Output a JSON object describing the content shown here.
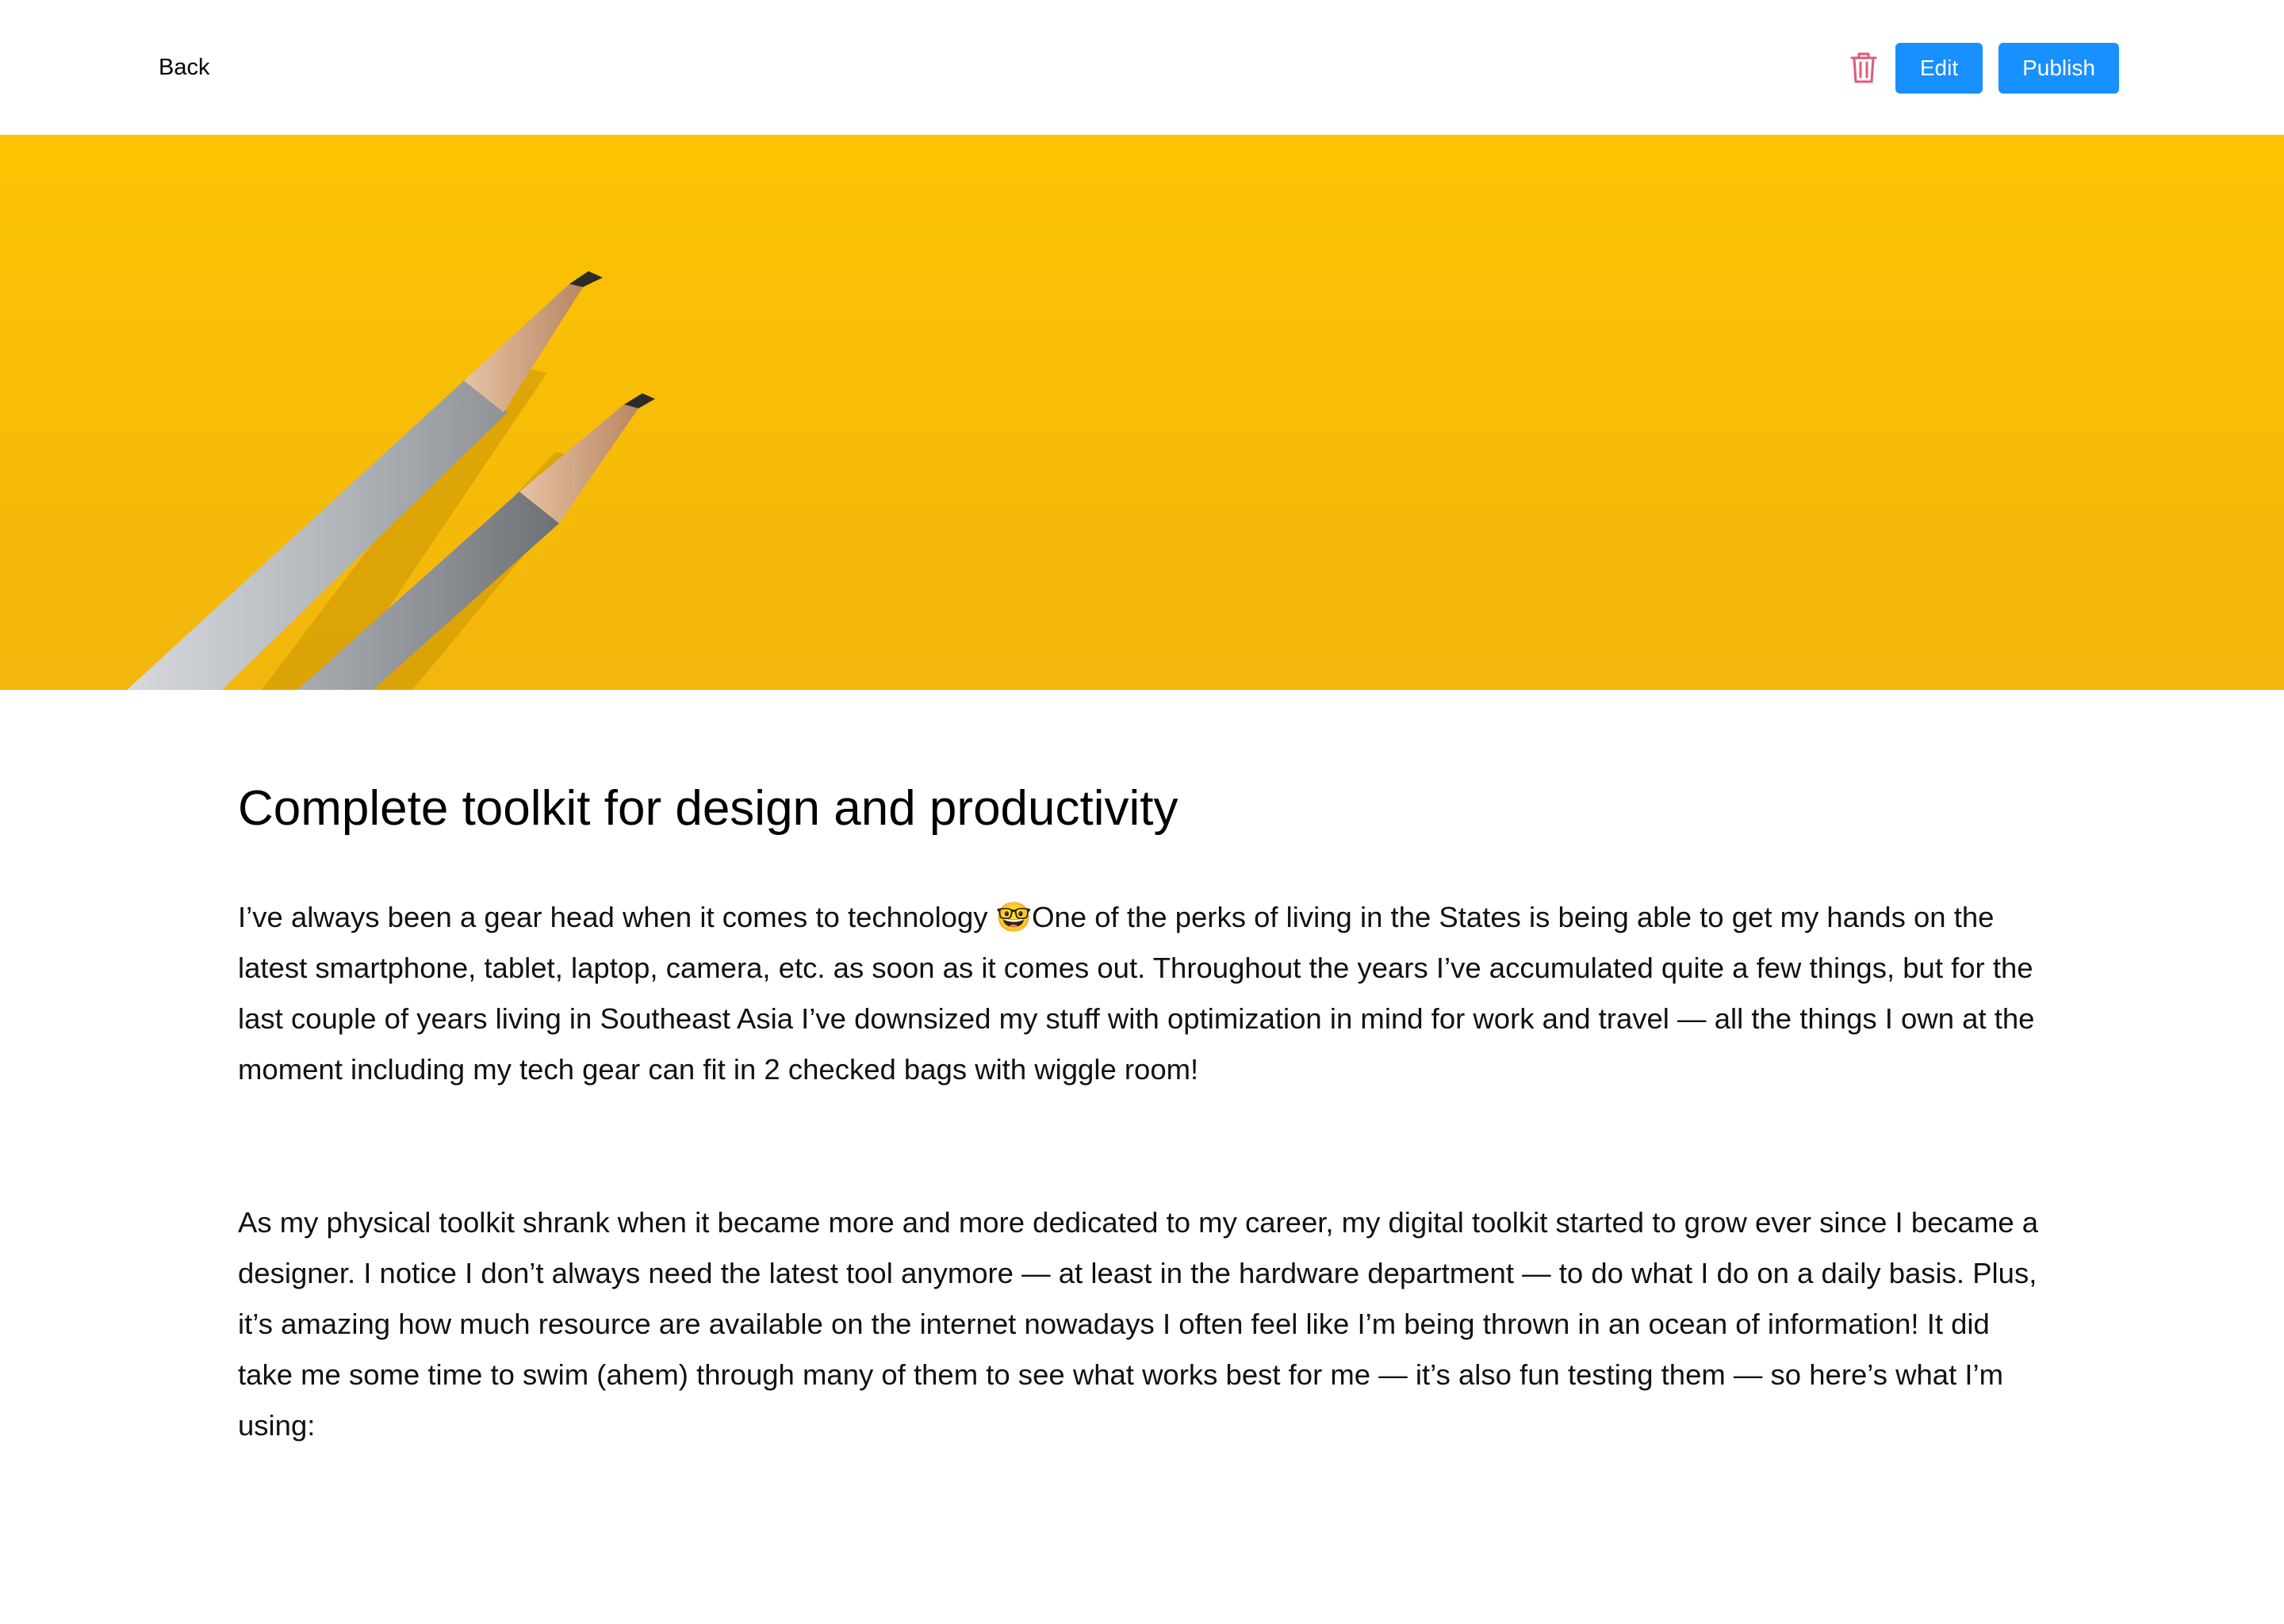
{
  "header": {
    "back_label": "Back",
    "delete_icon": "trash-icon",
    "edit_label": "Edit",
    "publish_label": "Publish"
  },
  "hero": {
    "image": "yellow-background-two-pencils",
    "colors": {
      "background": "#f8be06",
      "pencil_body": "#b9bcc1",
      "pencil_wood": "#d8aa86"
    }
  },
  "article": {
    "title": "Complete toolkit for design and productivity",
    "paragraphs": [
      "I’ve always been a gear head when it comes to technology 🤓One of the perks of living in the States is being able to get my hands on the latest smartphone, tablet, laptop, camera, etc. as soon as it comes out. Throughout the years I’ve accumulated quite a few things, but for the last couple of years living in Southeast Asia I’ve downsized my stuff with optimization in mind for work and travel — all the things I own at the moment including my tech gear can fit in 2 checked bags with wiggle room!",
      "As my physical toolkit shrank when it became more and more dedicated to my career, my digital toolkit started to grow ever since I became a designer. I notice I don’t always need the latest tool anymore — at least in the hardware department — to do what I do on a daily basis. Plus, it’s amazing how much resource are available on the internet nowadays I often feel like I’m being thrown in an ocean of information! It did take me some time to swim (ahem) through many of them to see what works best for me — it’s also fun testing them — so here’s what I’m using:"
    ]
  },
  "colors": {
    "primary_button": "#1890ff",
    "danger_icon": "#e05a78"
  }
}
